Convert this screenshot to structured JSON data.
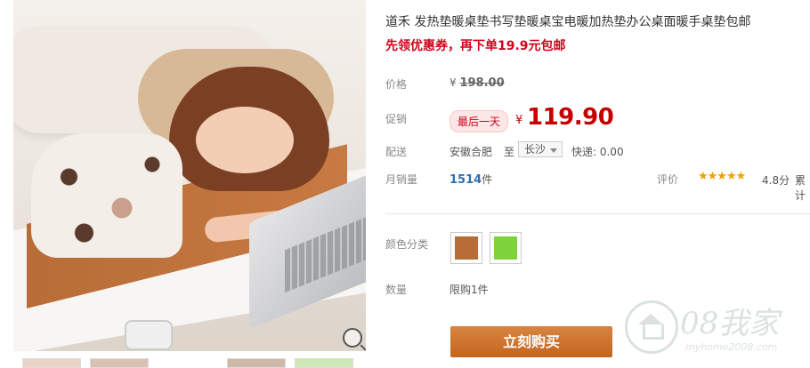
{
  "product": {
    "title": "道禾 发热垫暖桌垫书写垫暖桌宝电暖加热垫办公桌面暖手桌垫包邮",
    "promo": "先领优惠券，再下单19.9元包邮"
  },
  "labels": {
    "price": "价格",
    "promotion": "促销",
    "shipping": "配送",
    "monthly_sales": "月销量",
    "rating": "评价",
    "color": "颜色分类",
    "quantity": "数量"
  },
  "pricing": {
    "original_currency": "¥",
    "original_price": "198.00",
    "badge": "最后一天",
    "currency": "¥",
    "sale_price": "119.90"
  },
  "shipping": {
    "from": "安徽合肥",
    "to_label": "至",
    "city": "长沙",
    "express": "快递: 0.00"
  },
  "sales": {
    "count": "1514",
    "unit": "件"
  },
  "rating": {
    "stars": "★★★★★",
    "score": "4.8分",
    "more": "累计"
  },
  "colors": [
    {
      "name": "brown",
      "color": "#b86c37"
    },
    {
      "name": "green",
      "color": "#7fd33a"
    }
  ],
  "quantity": {
    "limit": "限购1件"
  },
  "buy_button": "立刻购买",
  "watermark": {
    "text": "08我家",
    "url": "myhome2008.com"
  }
}
